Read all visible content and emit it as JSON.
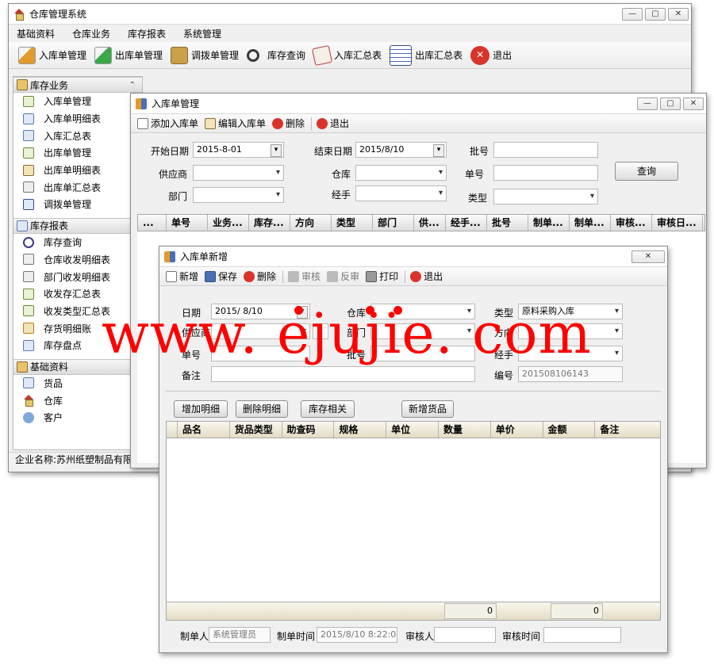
{
  "main_window": {
    "title": "仓库管理系统",
    "menu": [
      "基础资料",
      "仓库业务",
      "库存报表",
      "系统管理"
    ],
    "toolbar": [
      {
        "label": "入库单管理",
        "icon": "inbound-icon"
      },
      {
        "label": "出库单管理",
        "icon": "outbound-icon"
      },
      {
        "label": "调拨单管理",
        "icon": "transfer-icon"
      },
      {
        "label": "库存查询",
        "icon": "magnifier-icon"
      },
      {
        "label": "入库汇总表",
        "icon": "inbound-summary-icon"
      },
      {
        "label": "出库汇总表",
        "icon": "table-grid-icon"
      },
      {
        "label": "退出",
        "icon": "exit-icon"
      }
    ],
    "sidebar": {
      "groups": [
        {
          "title": "库存业务",
          "items": [
            "入库单管理",
            "入库单明细表",
            "入库汇总表",
            "出库单管理",
            "出库单明细表",
            "出库单汇总表",
            "调拨单管理"
          ]
        },
        {
          "title": "库存报表",
          "items": [
            "库存查询",
            "仓库收发明细表",
            "部门收发明细表",
            "收发存汇总表",
            "收发类型汇总表",
            "存货明细账",
            "库存盘点"
          ]
        },
        {
          "title": "基础资料",
          "items": [
            "货品",
            "仓库",
            "客户"
          ]
        }
      ]
    },
    "status": "企业名称:苏州纸塑制品有限公司"
  },
  "list_window": {
    "title": "入库单管理",
    "toolbar": [
      "添加入库单",
      "编辑入库单",
      "删除",
      "退出"
    ],
    "filters": {
      "start_date_label": "开始日期",
      "start_date": "2015-8-01",
      "end_date_label": "结束日期",
      "end_date": "2015/8/10",
      "batch_label": "批号",
      "supplier_label": "供应商",
      "warehouse_label": "仓库",
      "doc_no_label": "单号",
      "dept_label": "部门",
      "handler_label": "经手",
      "type_label": "类型",
      "query_button": "查询"
    },
    "columns": [
      "...",
      "单号",
      "业务...",
      "库存...",
      "方向",
      "类型",
      "部门",
      "供...",
      "经手...",
      "批号",
      "制单...",
      "制单...",
      "审核...",
      "审核日..."
    ]
  },
  "new_window": {
    "title": "入库单新增",
    "toolbar": [
      "新增",
      "保存",
      "删除",
      "审核",
      "反审",
      "打印",
      "退出"
    ],
    "form": {
      "date_label": "日期",
      "date": "2015/ 8/10",
      "warehouse_label": "仓库",
      "type_label": "类型",
      "type": "原料采购入库",
      "supplier_label": "供应商",
      "dept_label": "部门",
      "direction_label": "方向",
      "doc_no_label": "单号",
      "batch_label": "批号",
      "handler_label": "经手",
      "remark_label": "备注",
      "code_label": "编号",
      "code": "201508106143"
    },
    "buttons": [
      "增加明细",
      "删除明细",
      "库存相关",
      "新增货品"
    ],
    "columns": [
      "品名",
      "货品类型",
      "助查码",
      "规格",
      "单位",
      "数量",
      "单价",
      "金额",
      "备注"
    ],
    "totals": {
      "quantity": "0",
      "amount": "0"
    },
    "footer": {
      "maker_label": "制单人",
      "maker": "系统管理员",
      "make_time_label": "制单时间",
      "make_time": "2015/8/10 8:22:05",
      "auditor_label": "审核人",
      "audit_time_label": "审核时间"
    }
  },
  "watermark": "www. ejujie. com"
}
